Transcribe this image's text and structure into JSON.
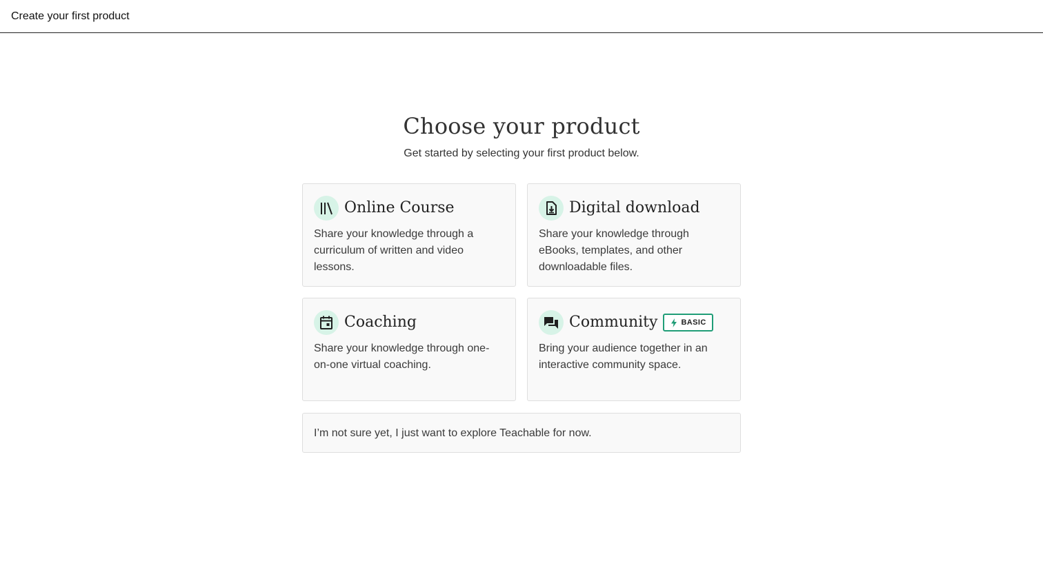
{
  "header": {
    "title": "Create your first product"
  },
  "main": {
    "heading": "Choose your product",
    "subheading": "Get started by selecting your first product below.",
    "products": [
      {
        "title": "Online Course",
        "description": "Share your knowledge through a curriculum of written and video lessons.",
        "icon": "library-books-icon"
      },
      {
        "title": "Digital download",
        "description": "Share your knowledge through eBooks, templates, and other downloadable files.",
        "icon": "file-download-icon"
      },
      {
        "title": "Coaching",
        "description": "Share your knowledge through one-on-one virtual coaching.",
        "icon": "calendar-icon"
      },
      {
        "title": "Community",
        "description": "Bring your audience together in an interactive community space.",
        "icon": "chat-bubbles-icon",
        "badge": {
          "label": "BASIC",
          "icon": "lightning-bolt-icon"
        }
      }
    ],
    "explore_option": "I’m not sure yet, I just want to explore Teachable for now."
  },
  "colors": {
    "accent": "#1f9d77",
    "icon_background": "#d7f3e7",
    "card_background": "#f9f9f9",
    "card_border": "#dedede"
  }
}
